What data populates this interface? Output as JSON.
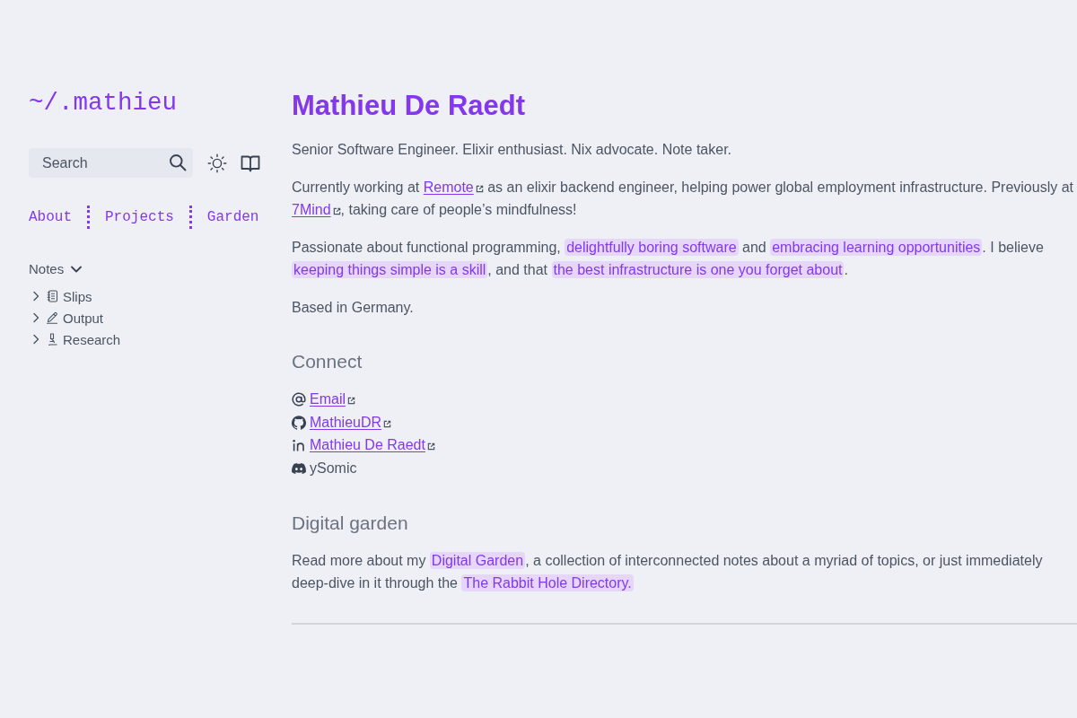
{
  "sidebar": {
    "logo": "~/.mathieu",
    "search": {
      "placeholder": "Search"
    },
    "nav": [
      "About",
      "Projects",
      "Garden"
    ],
    "notes": {
      "label": "Notes",
      "expanded": true,
      "children": [
        {
          "label": "Slips",
          "expanded": false
        },
        {
          "label": "Output",
          "expanded": false
        },
        {
          "label": "Research",
          "expanded": false
        }
      ]
    }
  },
  "main": {
    "title": "Mathieu De Raedt",
    "intro": [
      [
        {
          "kind": "text",
          "text": "Senior Software Engineer. Elixir enthusiast. Nix advocate. Note taker."
        }
      ],
      [
        {
          "kind": "text",
          "text": "Currently working at "
        },
        {
          "kind": "link",
          "text": "Remote",
          "external": true
        },
        {
          "kind": "text",
          "text": " as an elixir backend engineer, helping power global employment infrastructure. Previously at "
        },
        {
          "kind": "link",
          "text": "7Mind",
          "external": true
        },
        {
          "kind": "text",
          "text": ", taking care of people’s mindfulness!"
        }
      ],
      [
        {
          "kind": "text",
          "text": "Passionate about functional programming, "
        },
        {
          "kind": "highlight",
          "text": "delightfully boring software"
        },
        {
          "kind": "text",
          "text": " and "
        },
        {
          "kind": "highlight",
          "text": "embracing learning opportunities"
        },
        {
          "kind": "text",
          "text": ". I believe "
        },
        {
          "kind": "highlight",
          "text": "keeping things simple is a skill"
        },
        {
          "kind": "text",
          "text": ", and that "
        },
        {
          "kind": "highlight",
          "text": "the best infrastructure is one you forget about"
        },
        {
          "kind": "text",
          "text": "."
        }
      ],
      [
        {
          "kind": "text",
          "text": "Based in Germany."
        }
      ]
    ],
    "connect": {
      "heading": "Connect",
      "items": [
        {
          "text": "Email",
          "link": true,
          "external": true
        },
        {
          "text": "MathieuDR",
          "link": true,
          "external": true
        },
        {
          "text": "Mathieu De Raedt",
          "link": true,
          "external": true
        },
        {
          "text": "ySomic",
          "link": false,
          "external": false
        }
      ]
    },
    "garden": {
      "heading": "Digital garden",
      "paragraphs": [
        [
          {
            "kind": "text",
            "text": "Read more about my "
          },
          {
            "kind": "highlight",
            "text": "Digital Garden"
          },
          {
            "kind": "text",
            "text": ", a collection of interconnected notes about a myriad of topics, or just immediately deep-dive in it through the "
          },
          {
            "kind": "highlight",
            "text": "The Rabbit Hole Directory."
          }
        ]
      ]
    }
  }
}
